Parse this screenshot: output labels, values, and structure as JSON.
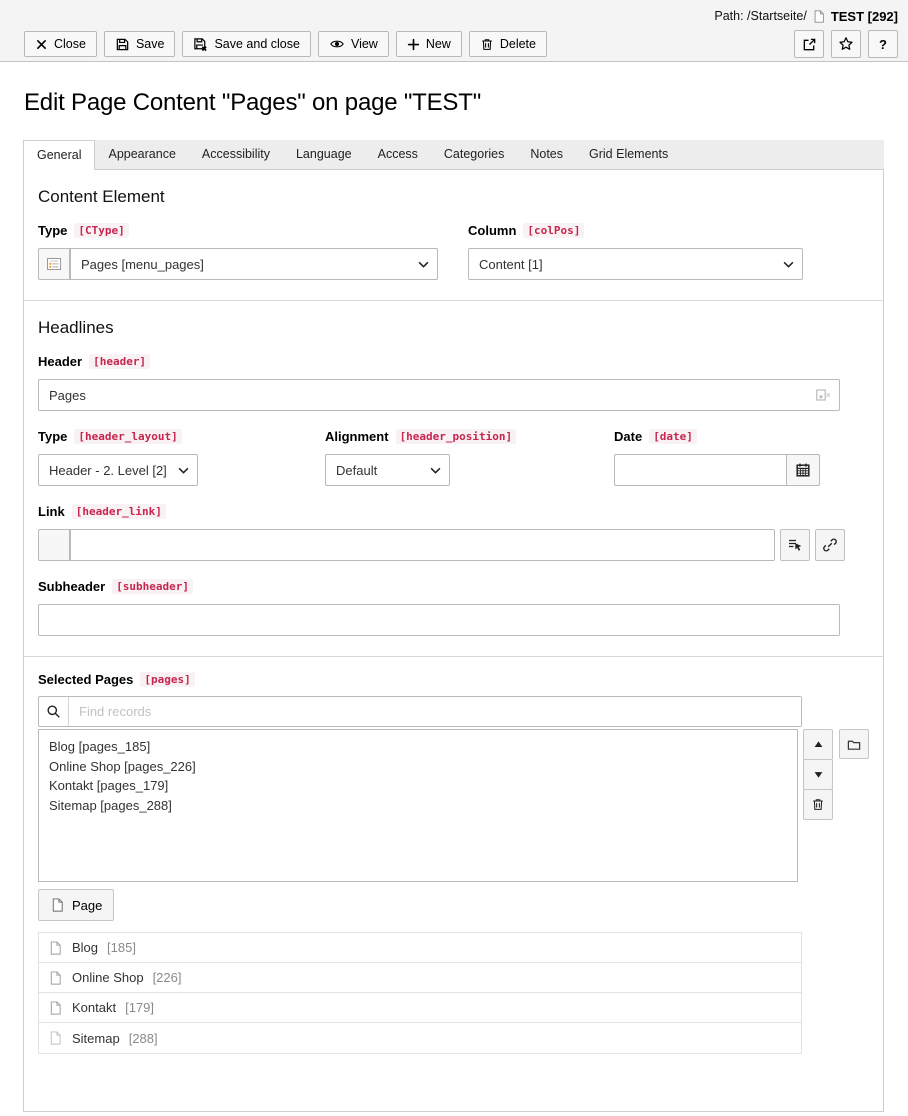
{
  "docheader": {
    "path_label": "Path: /Startseite/",
    "record_title": "TEST [292]",
    "buttons": {
      "close": "Close",
      "save": "Save",
      "save_and_close": "Save and close",
      "view": "View",
      "new": "New",
      "delete": "Delete",
      "help": "?"
    }
  },
  "page": {
    "title": "Edit Page Content \"Pages\" on page \"TEST\""
  },
  "tabs": [
    "General",
    "Appearance",
    "Accessibility",
    "Language",
    "Access",
    "Categories",
    "Notes",
    "Grid Elements"
  ],
  "active_tab": "General",
  "content_element": {
    "section_title": "Content Element",
    "type": {
      "label": "Type",
      "code": "[CType]",
      "value": "Pages [menu_pages]"
    },
    "column": {
      "label": "Column",
      "code": "[colPos]",
      "value": "Content [1]"
    }
  },
  "headlines": {
    "section_title": "Headlines",
    "header": {
      "label": "Header",
      "code": "[header]",
      "value": "Pages"
    },
    "type": {
      "label": "Type",
      "code": "[header_layout]",
      "value": "Header - 2. Level [2]"
    },
    "alignment": {
      "label": "Alignment",
      "code": "[header_position]",
      "value": "Default"
    },
    "date": {
      "label": "Date",
      "code": "[date]",
      "value": ""
    },
    "link": {
      "label": "Link",
      "code": "[header_link]",
      "value": ""
    },
    "subheader": {
      "label": "Subheader",
      "code": "[subheader]",
      "value": ""
    }
  },
  "selected_pages": {
    "label": "Selected Pages",
    "code": "[pages]",
    "search_placeholder": "Find records",
    "items": [
      "Blog [pages_185]",
      "Online Shop [pages_226]",
      "Kontakt [pages_179]",
      "Sitemap [pages_288]"
    ],
    "add_button": "Page",
    "records": [
      {
        "title": "Blog",
        "uid": "[185]"
      },
      {
        "title": "Online Shop",
        "uid": "[226]"
      },
      {
        "title": "Kontakt",
        "uid": "[179]"
      },
      {
        "title": "Sitemap",
        "uid": "[288]"
      }
    ]
  },
  "icons": [
    "close-icon",
    "save-icon",
    "save-close-icon",
    "view-eye-icon",
    "plus-icon",
    "trash-icon",
    "open-new-window-icon",
    "star-icon",
    "page-icon",
    "menu-pages-type-icon",
    "chevron-down-icon",
    "clear-field-icon",
    "calendar-icon",
    "record-browser-icon",
    "link-chain-icon",
    "search-icon",
    "arrow-up-icon",
    "arrow-down-icon",
    "folder-icon"
  ],
  "colors": {
    "code_color": "#c7254e",
    "code_bg": "#f9f2f4",
    "docheader_bg": "#f4f4f4",
    "tabbar_bg": "#ededed",
    "border": "#cecece",
    "bullet_orange": "#ff8700"
  }
}
